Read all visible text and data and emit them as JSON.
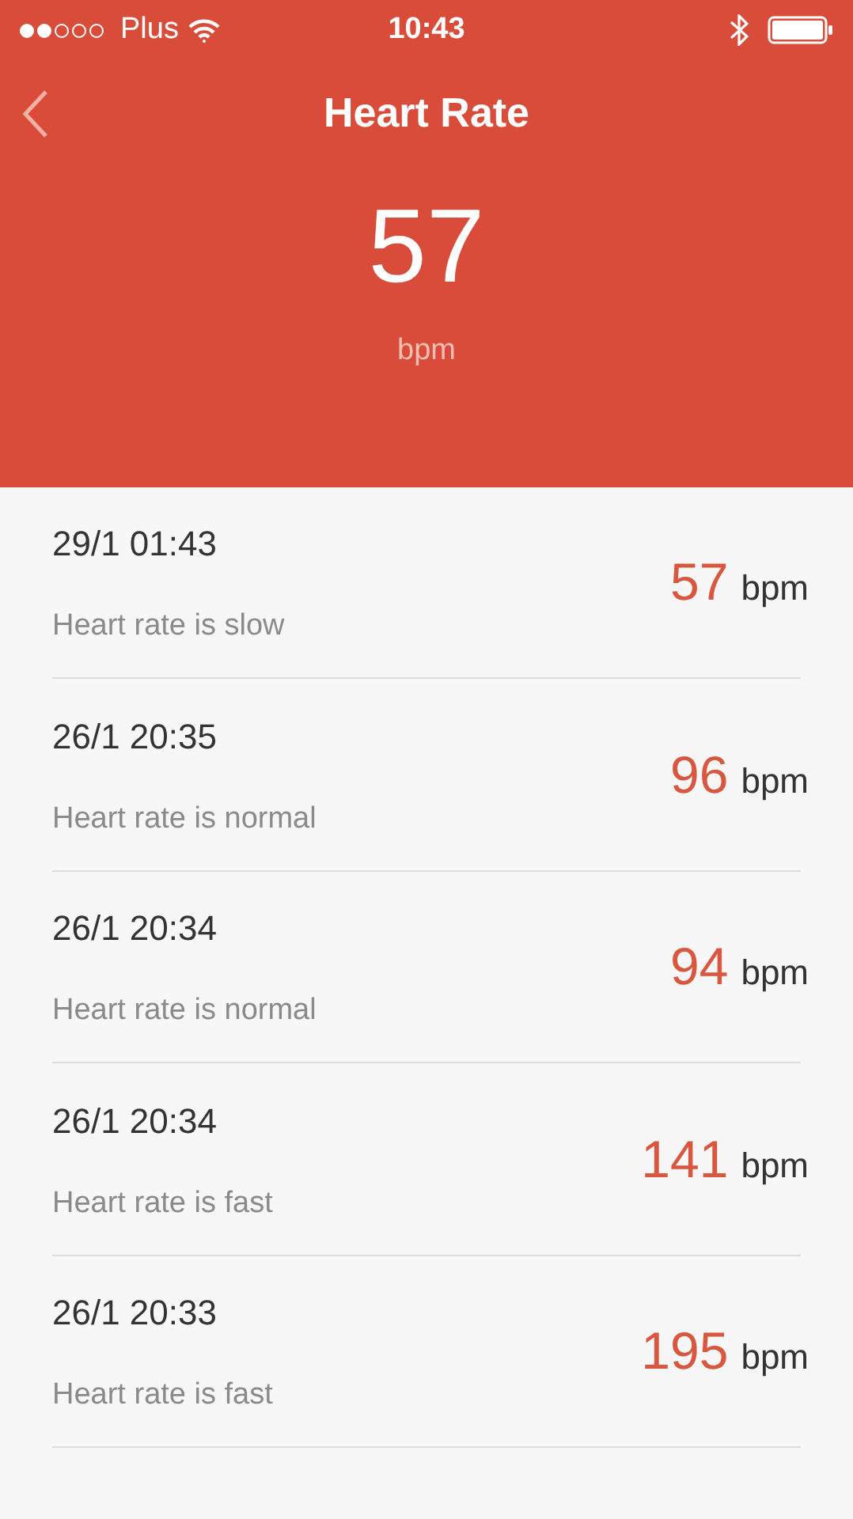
{
  "status_bar": {
    "carrier": "Plus",
    "time": "10:43"
  },
  "nav": {
    "title": "Heart Rate"
  },
  "current": {
    "value": "57",
    "unit": "bpm"
  },
  "readings": [
    {
      "time": "29/1 01:43",
      "note": "Heart rate is slow",
      "value": "57",
      "unit": "bpm"
    },
    {
      "time": "26/1 20:35",
      "note": "Heart rate is normal",
      "value": "96",
      "unit": "bpm"
    },
    {
      "time": "26/1 20:34",
      "note": "Heart rate is normal",
      "value": "94",
      "unit": "bpm"
    },
    {
      "time": "26/1 20:34",
      "note": "Heart rate is fast",
      "value": "141",
      "unit": "bpm"
    },
    {
      "time": "26/1 20:33",
      "note": "Heart rate is fast",
      "value": "195",
      "unit": "bpm"
    }
  ]
}
